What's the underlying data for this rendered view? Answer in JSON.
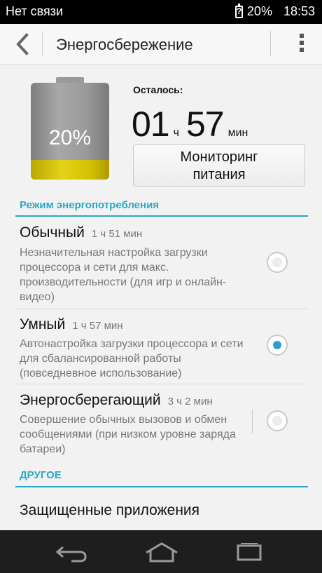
{
  "status_bar": {
    "carrier": "Нет связи",
    "battery_percent": "20%",
    "time": "18:53",
    "battery_icon_glyph": "?"
  },
  "action_bar": {
    "title": "Энергосбережение"
  },
  "battery": {
    "percent_label": "20%",
    "level_fraction": 0.2
  },
  "remaining": {
    "label": "Осталось:",
    "hours": "01",
    "hours_unit": "ч",
    "minutes": "57",
    "minutes_unit": "мин"
  },
  "monitor_button": {
    "line1": "Мониторинг",
    "line2": "питания"
  },
  "power_section": {
    "header": "Режим энергопотребления",
    "modes": [
      {
        "name": "Обычный",
        "time": "1 ч 51 мин",
        "description": "Незначительная настройка загрузки процессора и сети для макс. производительности (для игр и онлайн-видео)",
        "selected": false
      },
      {
        "name": "Умный",
        "time": "1 ч 57 мин",
        "description": "Автонастройка загрузки процессора и сети для сбалансированной работы (повседневное использование)",
        "selected": true
      },
      {
        "name": "Энергосберегающий",
        "time": "3 ч 2 мин",
        "description": "Совершение обычных вызовов и обмен сообщениями (при низком уровне заряда батареи)",
        "selected": false
      }
    ]
  },
  "other_section": {
    "header": "ДРУГОЕ",
    "items": [
      "Защищенные приложения"
    ]
  },
  "colors": {
    "accent": "#2aa8c6",
    "radio_selected": "#2a9fd0",
    "battery_fill": "#e2d21a"
  },
  "icons": [
    "back-icon",
    "overflow-menu-icon",
    "battery-icon",
    "nav-back-icon",
    "nav-home-icon",
    "nav-recents-icon"
  ]
}
